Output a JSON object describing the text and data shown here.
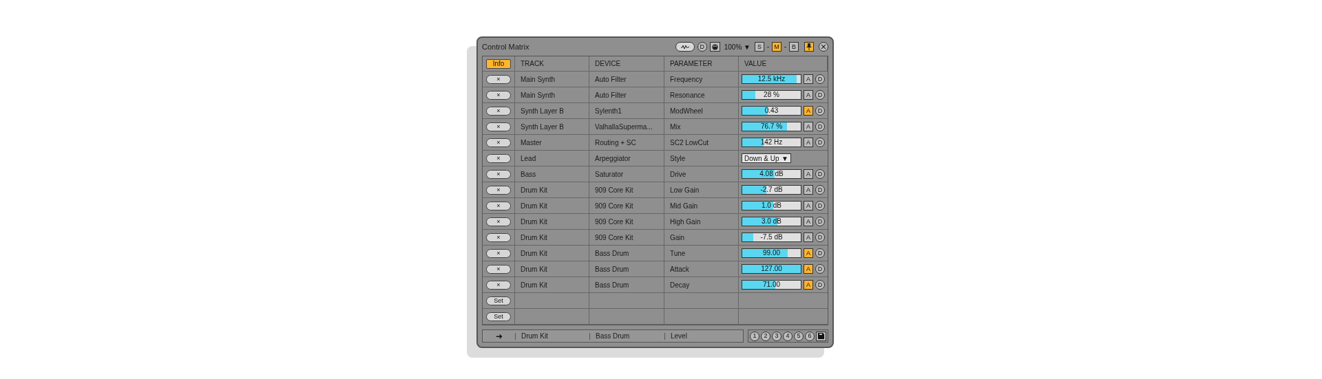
{
  "window": {
    "title": "Control Matrix"
  },
  "title_controls": {
    "device_button": "D",
    "zoom": "100%",
    "zoom_caret": "▼",
    "modes": [
      {
        "label": "S",
        "selected": false
      },
      {
        "label": "M",
        "selected": true
      },
      {
        "label": "B",
        "selected": false
      }
    ],
    "pinned": true
  },
  "info_button": {
    "label": "Info",
    "selected": true
  },
  "table": {
    "columns": [
      "TRACK",
      "DEVICE",
      "PARAMETER",
      "VALUE"
    ],
    "rows": [
      {
        "action": "×",
        "track": "Main Synth",
        "device": "Auto Filter",
        "parameter": "Frequency",
        "kind": "slider",
        "value": "12.5 kHz",
        "level": 0.93,
        "a_label": "A",
        "automated": false,
        "d_label": "D"
      },
      {
        "action": "×",
        "track": "Main Synth",
        "device": "Auto Filter",
        "parameter": "Resonance",
        "kind": "slider",
        "value": "28 %",
        "level": 0.22,
        "a_label": "A",
        "automated": false,
        "d_label": "D"
      },
      {
        "action": "×",
        "track": "Synth Layer B",
        "device": "Sylenth1",
        "parameter": "ModWheel",
        "kind": "slider",
        "value": "0.43",
        "level": 0.43,
        "a_label": "A",
        "automated": true,
        "d_label": "D"
      },
      {
        "action": "×",
        "track": "Synth Layer B",
        "device": "ValhallaSuperma...",
        "parameter": "Mix",
        "kind": "slider",
        "value": "76.7 %",
        "level": 0.77,
        "a_label": "A",
        "automated": false,
        "d_label": "D"
      },
      {
        "action": "×",
        "track": "Master",
        "device": "Routing + SC",
        "parameter": "SC2 LowCut",
        "kind": "slider",
        "value": "142 Hz",
        "level": 0.37,
        "a_label": "A",
        "automated": false,
        "d_label": "D"
      },
      {
        "action": "×",
        "track": "Lead",
        "device": "Arpeggiator",
        "parameter": "Style",
        "kind": "dropdown",
        "value": "Down & Up",
        "caret": "▼"
      },
      {
        "action": "×",
        "track": "Bass",
        "device": "Saturator",
        "parameter": "Drive",
        "kind": "slider",
        "value": "4.08 dB",
        "level": 0.55,
        "a_label": "A",
        "automated": false,
        "d_label": "D"
      },
      {
        "action": "×",
        "track": "Drum Kit",
        "device": "909 Core Kit",
        "parameter": "Low Gain",
        "kind": "slider",
        "value": "-2.7 dB",
        "level": 0.41,
        "a_label": "A",
        "automated": false,
        "d_label": "D"
      },
      {
        "action": "×",
        "track": "Drum Kit",
        "device": "909 Core Kit",
        "parameter": "Mid Gain",
        "kind": "slider",
        "value": "1.0 dB",
        "level": 0.53,
        "a_label": "A",
        "automated": false,
        "d_label": "D"
      },
      {
        "action": "×",
        "track": "Drum Kit",
        "device": "909 Core Kit",
        "parameter": "High Gain",
        "kind": "slider",
        "value": "3.0 dB",
        "level": 0.6,
        "a_label": "A",
        "automated": false,
        "d_label": "D"
      },
      {
        "action": "×",
        "track": "Drum Kit",
        "device": "909 Core Kit",
        "parameter": "Gain",
        "kind": "slider",
        "value": "-7.5 dB",
        "level": 0.19,
        "a_label": "A",
        "automated": false,
        "d_label": "D"
      },
      {
        "action": "×",
        "track": "Drum Kit",
        "device": "Bass Drum",
        "parameter": "Tune",
        "kind": "slider",
        "value": "99.00",
        "level": 0.78,
        "a_label": "A",
        "automated": true,
        "d_label": "D"
      },
      {
        "action": "×",
        "track": "Drum Kit",
        "device": "Bass Drum",
        "parameter": "Attack",
        "kind": "slider",
        "value": "127.00",
        "level": 1,
        "a_label": "A",
        "automated": true,
        "d_label": "D"
      },
      {
        "action": "×",
        "track": "Drum Kit",
        "device": "Bass Drum",
        "parameter": "Decay",
        "kind": "slider",
        "value": "71.00",
        "level": 0.57,
        "a_label": "A",
        "automated": true,
        "d_label": "D"
      },
      {
        "action": "Set",
        "kind": "empty"
      },
      {
        "action": "Set",
        "kind": "empty"
      }
    ]
  },
  "footer": {
    "arrow": "➜",
    "track": "Drum Kit",
    "device": "Bass Drum",
    "parameter": "Level",
    "slots": [
      "1",
      "2",
      "3",
      "4",
      "5",
      "6"
    ]
  }
}
